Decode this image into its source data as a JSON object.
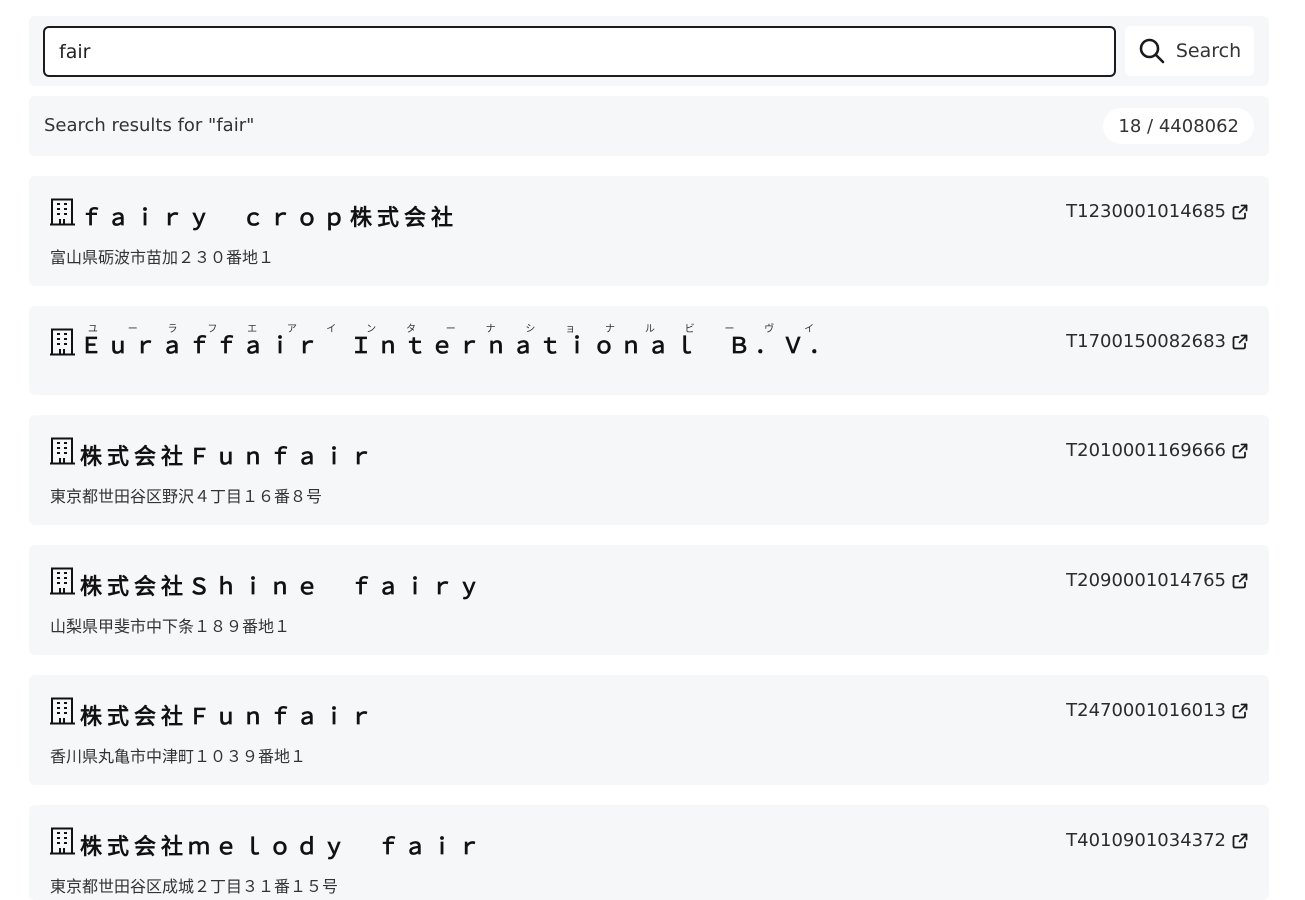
{
  "search": {
    "value": "fair",
    "button_label": "Search",
    "button_icon": "search-icon"
  },
  "results": {
    "title": "Search results for \"fair\"",
    "count": "18 / 4408062"
  },
  "items": [
    {
      "name": "ｆａｉｒｙ　ｃｒｏｐ株式会社",
      "address": "富山県砺波市苗加２３０番地１",
      "registration": "T1230001014685"
    },
    {
      "name": "Ｅｕｒａｆｆａｉｒ　Ｉｎｔｅｒｎａｔｉｏｎａｌ　Ｂ．Ｖ．",
      "furigana": "ユーラフエアインターナショナルビーヴイ",
      "address": "",
      "registration": "T1700150082683"
    },
    {
      "name": "株式会社Ｆｕｎｆａｉｒ",
      "address": "東京都世田谷区野沢４丁目１６番８号",
      "registration": "T2010001169666"
    },
    {
      "name": "株式会社Ｓｈｉｎｅ　ｆａｉｒｙ",
      "address": "山梨県甲斐市中下条１８９番地１",
      "registration": "T2090001014765"
    },
    {
      "name": "株式会社Ｆｕｎｆａｉｒ",
      "address": "香川県丸亀市中津町１０３９番地１",
      "registration": "T2470001016013"
    },
    {
      "name": "株式会社ｍｅｌｏｄｙ　ｆａｉｒ",
      "address": "東京都世田谷区成城２丁目３１番１５号",
      "registration": "T4010901034372"
    }
  ]
}
